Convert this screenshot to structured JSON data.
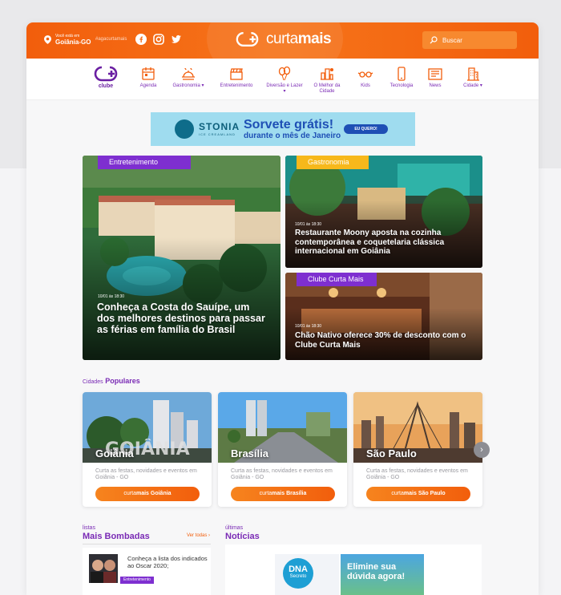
{
  "header": {
    "location_small": "Você está em",
    "location_city": "Goiânia-GO",
    "hashtag": "#agacurtamais",
    "social": [
      "facebook-icon",
      "instagram-icon",
      "twitter-icon"
    ],
    "logo_prefix": "curta",
    "logo_bold": "mais",
    "search_label": "Buscar"
  },
  "nav": {
    "items": [
      {
        "label": "clube",
        "icon": "clube-logo-icon"
      },
      {
        "label": "Agenda",
        "icon": "calendar-icon"
      },
      {
        "label": "Gastronomia ▾",
        "icon": "dish-icon"
      },
      {
        "label": "Entretenimento",
        "icon": "clapperboard-icon"
      },
      {
        "label": "Diversão e Lazer ▾",
        "icon": "balloons-icon"
      },
      {
        "label": "O Melhor da Cidade",
        "icon": "city-award-icon"
      },
      {
        "label": "Kids",
        "icon": "glasses-icon"
      },
      {
        "label": "Tecnologia",
        "icon": "phone-icon"
      },
      {
        "label": "News",
        "icon": "newspaper-icon"
      },
      {
        "label": "Cidade ▾",
        "icon": "building-icon"
      }
    ]
  },
  "ad": {
    "brand": "STONIA",
    "brand_sub": "ICE CREAMLAND",
    "headline": "Sorvete grátis!",
    "subline": "durante o mês de Janeiro",
    "cta": "EU QUERO!"
  },
  "featured": [
    {
      "tag": "Entretenimento",
      "date": "10/01 às 18:30",
      "title": "Conheça a Costa do Sauípe, um dos melhores destinos para passar as férias em família do Brasil"
    },
    {
      "tag": "Gastronomia",
      "date": "10/01 às 18:30",
      "title": "Restaurante Moony aposta na cozinha contemporânea e coquetelaria clássica internacional em Goiânia"
    },
    {
      "tag": "Clube Curta Mais",
      "date": "10/01 às 18:30",
      "title": "Chão Nativo oferece 30% de desconto com o Clube Curta Mais"
    }
  ],
  "cities": {
    "section_prefix": "Cidades",
    "section_bold": "Populares",
    "items": [
      {
        "name": "Goiânia",
        "desc": "Curta as festas, novidades e eventos em Goiânia - GO",
        "btn_prefix": "curta",
        "btn_bold": "mais",
        "btn_city": "Goiânia",
        "overlay": "GOIÂNIA"
      },
      {
        "name": "Brasília",
        "desc": "Curta as festas, novidades e eventos em Goiânia - GO",
        "btn_prefix": "curta",
        "btn_bold": "mais",
        "btn_city": "Brasília"
      },
      {
        "name": "São Paulo",
        "desc": "Curta as festas, novidades e eventos em Goiânia - GO",
        "btn_prefix": "curta",
        "btn_bold": "mais",
        "btn_city": "São Paulo"
      }
    ],
    "next_arrow": "›"
  },
  "lists": {
    "small": "listas",
    "title": "Mais Bombadas",
    "see_all": "Ver todas ›",
    "item_title": "Conheça a lista dos indicados ao Oscar 2020;",
    "item_tag": "Entretenimento"
  },
  "news": {
    "small": "últimas",
    "title": "Notícias",
    "ad_logo_top": "DNA",
    "ad_logo_bottom": "Secreto",
    "ad_text": "Elimine sua dúvida agora!"
  }
}
